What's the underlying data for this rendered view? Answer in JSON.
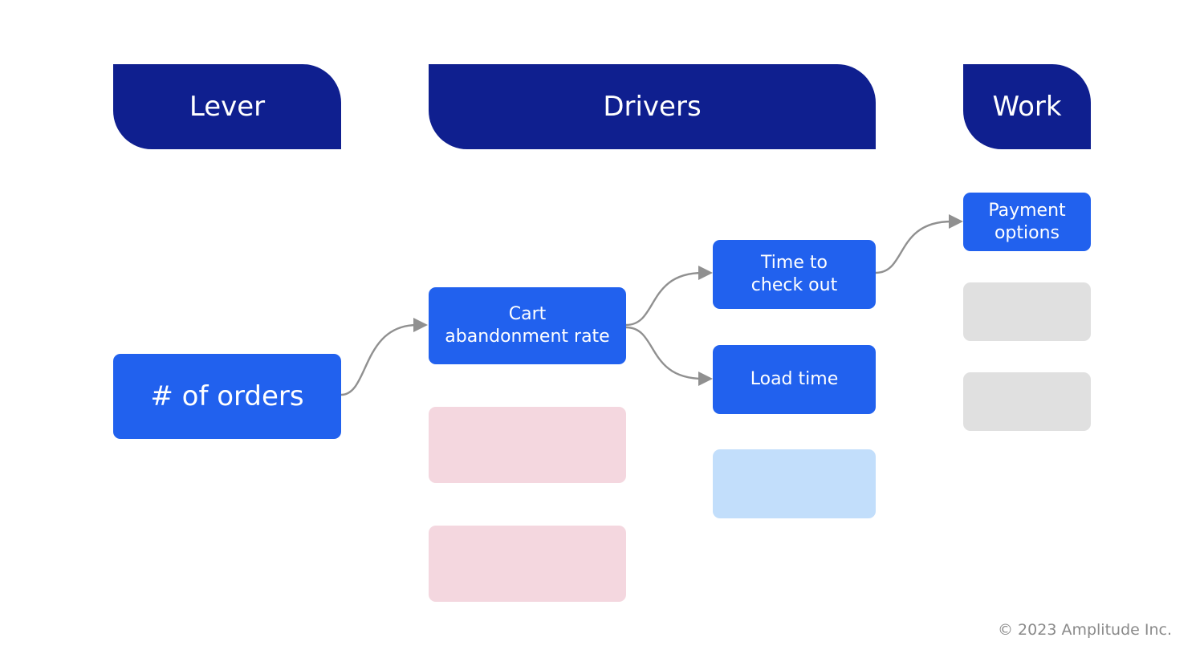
{
  "headers": {
    "lever": "Lever",
    "drivers": "Drivers",
    "work": "Work"
  },
  "nodes": {
    "orders": "# of orders",
    "cart_abandonment": "Cart\nabandonment rate",
    "time_to_checkout": "Time to\ncheck out",
    "load_time": "Load time",
    "payment_options": "Payment\noptions"
  },
  "placeholders": {
    "drivers_col1": [
      "pink",
      "pink"
    ],
    "drivers_col2": [
      "lightblue"
    ],
    "work": [
      "gray",
      "gray"
    ]
  },
  "connections": [
    {
      "from": "# of orders",
      "to": "Cart abandonment rate"
    },
    {
      "from": "Cart abandonment rate",
      "to": "Time to check out"
    },
    {
      "from": "Cart abandonment rate",
      "to": "Load time"
    },
    {
      "from": "Time to check out",
      "to": "Payment options"
    }
  ],
  "colors": {
    "header": "#0f1f8f",
    "node": "#2161ee",
    "placeholder_pink": "#f4d7df",
    "placeholder_blue": "#c2defb",
    "placeholder_gray": "#e0e0e0",
    "arrow": "#909090"
  },
  "footer": {
    "copyright": "© 2023 Amplitude Inc."
  }
}
